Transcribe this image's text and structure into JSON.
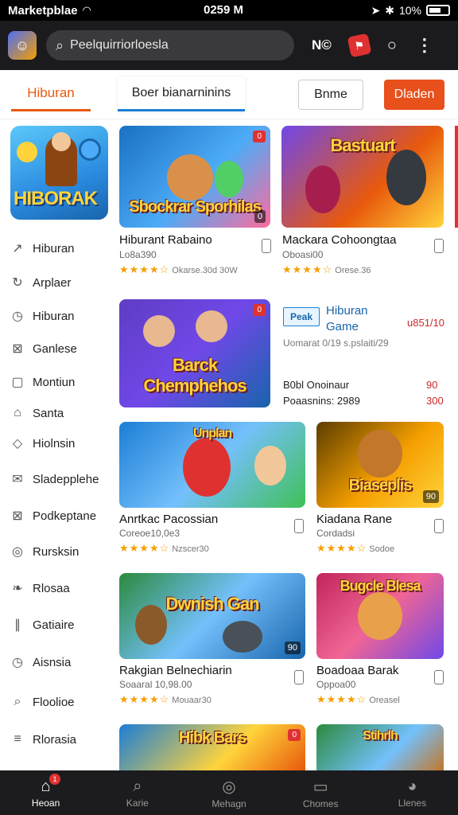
{
  "status_bar": {
    "app_name": "Marketpblae",
    "time": "0259 M",
    "battery": "10%"
  },
  "header": {
    "search_value": "Peelquirriorloesla",
    "label": "N©",
    "badge_icon": "game-badge-icon",
    "colors": {
      "bg": "#1b1b1d",
      "accent": "#e03131"
    }
  },
  "tabs": {
    "tab1": "Hiburan",
    "tab2": "Boer bianarninins",
    "button_game": "Bnme",
    "button_primary": "Dladen"
  },
  "sidebar": {
    "items": [
      {
        "label": "Hiburan",
        "icon": "tag-icon"
      },
      {
        "label": "Arplaer",
        "icon": "refresh-icon"
      },
      {
        "label": "Hiburan",
        "icon": "clock-icon"
      },
      {
        "label": "Ganlese",
        "icon": "grid-icon"
      },
      {
        "label": "Montiun",
        "icon": "square-icon"
      },
      {
        "label": "Santa",
        "icon": "home-icon"
      },
      {
        "label": "Hiolnsin",
        "icon": "diamond-icon"
      },
      {
        "label": "Sladepplehe",
        "icon": "chat-icon"
      },
      {
        "label": "Podkeptane",
        "icon": "box-icon"
      },
      {
        "label": "Rursksin",
        "icon": "circle-icon"
      },
      {
        "label": "Rlosaa",
        "icon": "leaf-icon"
      },
      {
        "label": "Gatiaire",
        "icon": "bars-icon"
      },
      {
        "label": "Aisnsia",
        "icon": "clock-icon"
      },
      {
        "label": "Floolioe",
        "icon": "search-icon"
      },
      {
        "label": "Rlorasia",
        "icon": "menu-icon"
      }
    ]
  },
  "cards": {
    "c1": {
      "art": "Sbockrar Sporhilas",
      "badge": "0",
      "tag": "0",
      "title": "Hiburant Rabaino",
      "sub": "Lo8a390",
      "rating": "30W",
      "rating_sub": "Okarse.30d"
    },
    "c2": {
      "art": "Bastuart",
      "title": "Mackara Cohoongtaa",
      "sub": "Oboasi00",
      "rating_sub": "Orese.36"
    },
    "c3": {
      "art": "Barck Chemphehos",
      "badge": "0"
    },
    "c4": {
      "art": "Unplan",
      "title": "Anrtkac Pacossian",
      "sub": "Coreoe10,0e3",
      "rating_sub": "Nzscer30"
    },
    "c5": {
      "art": "Biaseplis",
      "tag": "90",
      "title": "Kiadana Rane",
      "sub": "Cordadsi",
      "rating_sub": "Sodoe"
    },
    "c6": {
      "art": "Dwnish Gan",
      "tag": "90",
      "title": "Rakgian Belnechiarin",
      "sub": "Soaaral 10,98.00",
      "rating_sub": "Mouaar30"
    },
    "c7": {
      "art": "Bugcle Blesa",
      "title": "Boadoaa Barak",
      "sub": "Oppoa00",
      "rating_sub": "Oreasel"
    },
    "c8": {
      "art": "Hibk Bars",
      "badge": "0"
    },
    "c9": {
      "art": "Stihrlh"
    }
  },
  "promo": {
    "logo": "Peak",
    "title1": "Hiburan",
    "title2": "Game",
    "price": "u851/10",
    "meta": "Uomarat 0/19 s.pslaiti/29",
    "line1": "B0bl Onoinaur",
    "line1_val": "90",
    "line2": "Poaasnins: 2989",
    "line2_val": "300"
  },
  "bottom_nav": [
    {
      "label": "Heoan",
      "icon": "home-icon",
      "badge": "1"
    },
    {
      "label": "Karie",
      "icon": "search-icon"
    },
    {
      "label": "Mehagn",
      "icon": "compass-icon"
    },
    {
      "label": "Chomes",
      "icon": "display-icon"
    },
    {
      "label": "Llenes",
      "icon": "user-icon"
    }
  ]
}
